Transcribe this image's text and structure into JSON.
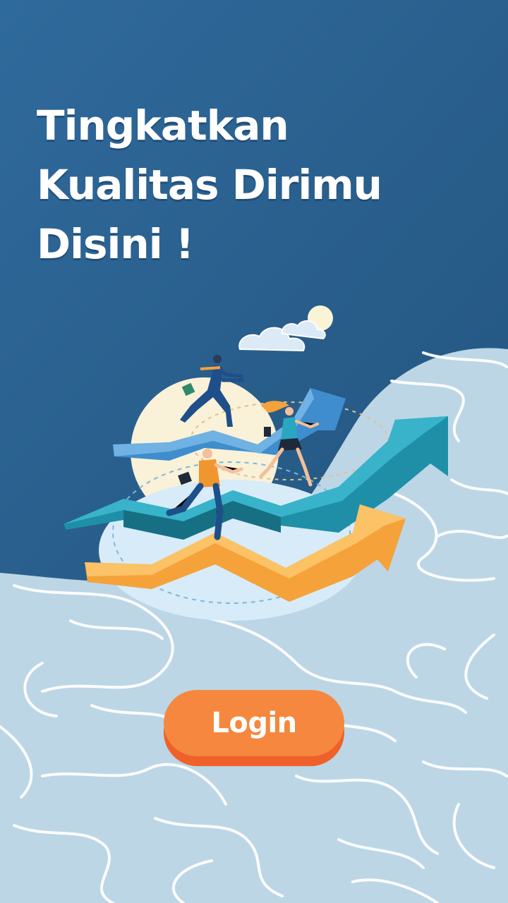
{
  "headline": {
    "line1": "Tingkatkan",
    "line2": "Kualitas Dirimu",
    "line3": "Disini !"
  },
  "login_button": {
    "label": "Login"
  },
  "colors": {
    "top_background": "#2c6394",
    "bottom_background": "#bcd6e6",
    "button": "#f5883e",
    "button_shadow": "#f0602a",
    "text": "#ffffff"
  },
  "illustration": {
    "icon": "growth-arrows-runners-illustration"
  }
}
